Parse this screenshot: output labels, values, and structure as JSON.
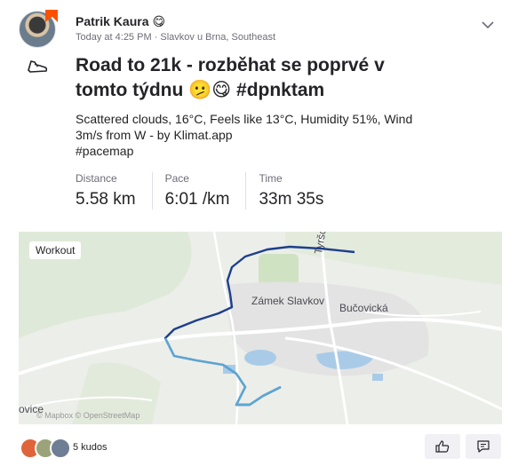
{
  "athlete": {
    "name": "Patrik Kaura",
    "emoji": "😋",
    "date": "Today at 4:25 PM",
    "location": "Slavkov u Brna, Southeast"
  },
  "activity": {
    "title": "Road to 21k - rozběhat se poprvé v tomto týdnu 🫤😋 #dpnktam",
    "description_line1": "Scattered clouds, 16°C, Feels like 13°C, Humidity 51%, Wind 3m/s from W - by Klimat.app",
    "description_line2": "#pacemap",
    "stats": [
      {
        "label": "Distance",
        "value": "5.58 km"
      },
      {
        "label": "Pace",
        "value": "6:01 /km"
      },
      {
        "label": "Time",
        "value": "33m 35s"
      }
    ]
  },
  "map": {
    "chip": "Workout",
    "labels": {
      "castle": "Zámek Slavkov",
      "street1": "Bučovická",
      "street2": "Tyršova",
      "town": "ovice"
    },
    "attribution": "© Mapbox © OpenStreetMap"
  },
  "kudos": {
    "text": "5 kudos",
    "avatar_colors": [
      "#e0643a",
      "#9aa37a",
      "#6e7e94"
    ]
  },
  "colors": {
    "brand": "#fc5200",
    "route_dark": "#1d3f8c",
    "route_light": "#5aa6d6"
  },
  "icons": {
    "shoe": "shoe-icon",
    "chevron": "chevron-down-icon",
    "kudos": "thumbs-up-icon",
    "comment": "comment-icon"
  }
}
